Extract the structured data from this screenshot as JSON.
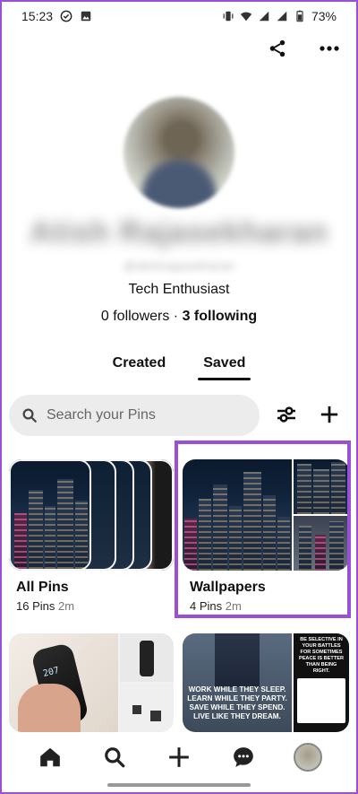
{
  "status_bar": {
    "time": "15:23",
    "battery": "73%",
    "left_icons": [
      "check-circle-icon",
      "image-icon"
    ],
    "right_icons": [
      "vibrate-icon",
      "wifi-icon",
      "signal-icon",
      "signal-icon",
      "battery-icon"
    ]
  },
  "header_actions": {
    "icons": [
      "share-icon",
      "more-icon"
    ]
  },
  "profile": {
    "name": "Atish Rajasekharan",
    "handle": "@atishrajasekharan",
    "bio": "Tech Enthusiast",
    "followers_count": "0 followers",
    "separator": " · ",
    "following_count": "3 following"
  },
  "tabs": [
    {
      "label": "Created",
      "active": false
    },
    {
      "label": "Saved",
      "active": true
    }
  ],
  "search": {
    "placeholder": "Search your Pins"
  },
  "boards": [
    {
      "title": "All Pins",
      "pin_count": "16 Pins",
      "updated": "2m"
    },
    {
      "title": "Wallpapers",
      "pin_count": "4 Pins",
      "updated": "2m",
      "highlighted": true
    }
  ],
  "pins": {
    "left": {
      "text": "207"
    },
    "right": {
      "overlay_text": "WORK WHILE THEY SLEEP.\nLEARN WHILE THEY PARTY.\nSAVE WHILE THEY SPEND.\nLIVE LIKE THEY DREAM.",
      "side_text": "BE SELECTIVE IN YOUR BATTLES FOR SOMETIMES PEACE IS BETTER THAN BEING RIGHT."
    }
  },
  "bottom_nav": {
    "items": [
      "home-icon",
      "search-icon",
      "add-icon",
      "messages-icon",
      "profile-avatar"
    ]
  },
  "colors": {
    "highlight": "#9b4fd6",
    "search_bg": "#ececec"
  }
}
